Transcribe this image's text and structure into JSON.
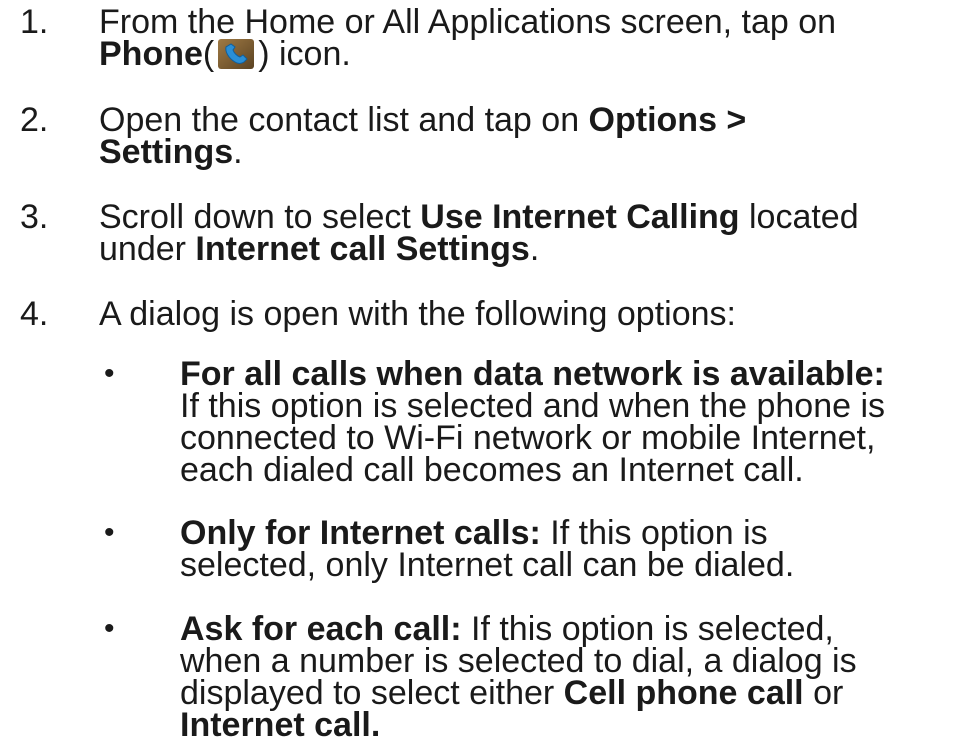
{
  "steps": [
    {
      "number": "1.",
      "l1": "From the Home or All Applications screen, tap on",
      "phone_label": "Phone",
      "paren_open": "(",
      "paren_close": ") icon."
    },
    {
      "number": "2.",
      "l1a": "Open the contact list and tap on ",
      "options_label": "Options >",
      "settings_label": "Settings",
      "period": "."
    },
    {
      "number": "3.",
      "l1a": "Scroll down to select ",
      "use_internet_label": "Use Internet Calling",
      "l1b": " located",
      "l2a": "under ",
      "internet_settings_label": "Internet call Settings",
      "period": "."
    },
    {
      "number": "4.",
      "text": "A dialog is open with the following options:"
    }
  ],
  "options": [
    {
      "bullet": "•",
      "title": "For all calls when data network is available:",
      "line2": "If this option is selected and when the phone is",
      "line3": "connected to Wi-Fi network or mobile Internet,",
      "line4": "each dialed call becomes an Internet call."
    },
    {
      "bullet": "•",
      "title": "Only for Internet calls:",
      "line1_rest": " If this option is",
      "line2": "selected, only Internet call can be dialed."
    },
    {
      "bullet": "•",
      "title": "Ask for each call:",
      "line1_rest": " If this option is selected,",
      "line2": "when a number is selected to dial, a dialog is",
      "line3a": "displayed to select either ",
      "cell_label": "Cell phone call",
      "line3b": " or",
      "internet_label": "Internet call."
    }
  ],
  "icons": {
    "phone_icon": "phone-handset-icon",
    "phone_icon_bg": "#8a6a3a",
    "phone_icon_fg": "#2a8fd6"
  }
}
